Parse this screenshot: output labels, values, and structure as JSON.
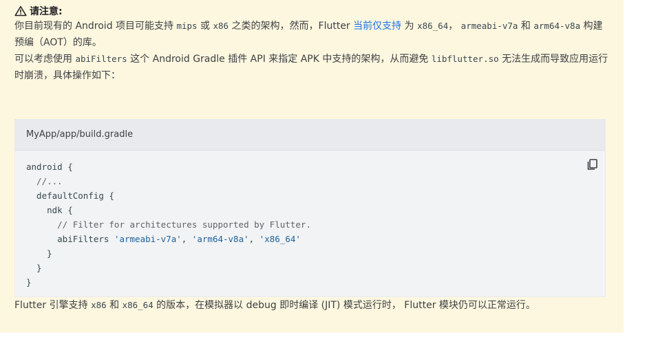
{
  "notice": {
    "title": "请注意:",
    "icon": "warning-icon"
  },
  "p1": {
    "t1": "你目前现有的 Android 项目可能支持 ",
    "c1": "mips",
    "t2": " 或 ",
    "c2": "x86",
    "t3": " 之类的架构，然而，Flutter ",
    "link": "当前仅支持",
    "t4": " 为 ",
    "c3": "x86_64",
    "t5": "， ",
    "c4": "armeabi-v7a",
    "t6": " 和 ",
    "c5": "arm64-v8a",
    "t7": " 构建预编（AOT）的库。"
  },
  "p2": {
    "t1": "可以考虑使用 ",
    "c1": "abiFilters",
    "t2": " 这个 Android Gradle 插件 API 来指定 APK 中支持的架构，从而避免 ",
    "c2": "libflutter.so",
    "t3": " 无法生成而导致应用运行时崩溃，具体操作如下："
  },
  "code": {
    "filename": "MyApp/app/build.gradle",
    "copy_icon": "copy-icon",
    "lines": {
      "l1": "android {",
      "l2": "  //...",
      "l3": "  defaultConfig {",
      "l4": "    ndk {",
      "l5_comment": "      // Filter for architectures supported by Flutter.",
      "l6_pre": "      abiFilters ",
      "l6_s1": "'armeabi-v7a'",
      "l6_sep1": ", ",
      "l6_s2": "'arm64-v8a'",
      "l6_sep2": ", ",
      "l6_s3": "'x86_64'",
      "l7": "    }",
      "l8": "  }",
      "l9": "}"
    }
  },
  "p3": {
    "t1": "Flutter 引擎支持 ",
    "c1": "x86",
    "t2": " 和 ",
    "c2": "x86_64",
    "t3": " 的版本，在模拟器以 debug 即时编译 (JIT) 模式运行时， Flutter 模块仍可以正常运行。"
  },
  "colors": {
    "notice_bg": "#fef7e0",
    "link": "#1a73e8",
    "code_bg": "#f1f3f4",
    "code_header_bg": "#e8eaed",
    "string": "#1e5f9c"
  }
}
